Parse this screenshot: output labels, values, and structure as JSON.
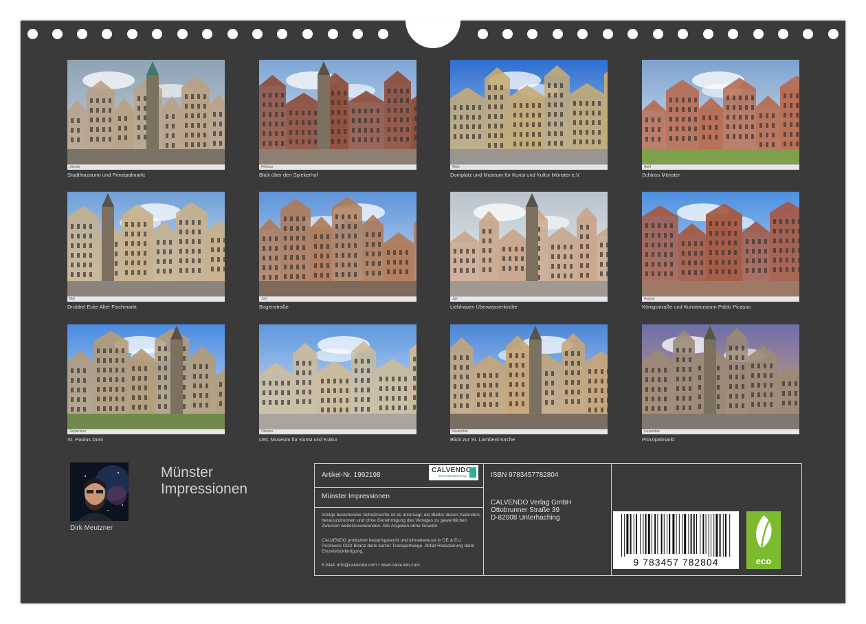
{
  "photos": [
    {
      "caption": "Stadthausturm und Prinzipalmarkt",
      "month": "Januar"
    },
    {
      "caption": "Blick über den Spiekerhof",
      "month": "Februar"
    },
    {
      "caption": "Domplatz und Museum für Kunst und Kultur Münster e.V.",
      "month": "März"
    },
    {
      "caption": "Schloss Münster",
      "month": "April"
    },
    {
      "caption": "Drubbel Ecke Alter Fischmarkt",
      "month": "Mai"
    },
    {
      "caption": "Bogenstraße",
      "month": "Juni"
    },
    {
      "caption": "Liebfrauen Überwasserkirche",
      "month": "Juli"
    },
    {
      "caption": "Königsstraße und Kunstmuseum Pablo Picasso",
      "month": "August"
    },
    {
      "caption": "St. Paulus Dom",
      "month": "September"
    },
    {
      "caption": "LWL Museum für Kunst und Kultur",
      "month": "Oktober"
    },
    {
      "caption": "Blick zur St. Lamberti Kirche",
      "month": "November"
    },
    {
      "caption": "Prinzipalmarkt",
      "month": "Dezember"
    }
  ],
  "author": {
    "name": "Dirk Meutzner"
  },
  "cover": {
    "title_line1": "Münster",
    "title_line2": "Impressionen"
  },
  "info": {
    "article_no": "Artikel-Nr. 1992198",
    "product_title": "Münster Impressionen",
    "legal_text": "Infolge bestehender Schutzrechte ist es untersagt, die Blätter dieses Kalenders herauszutrennen und ohne Genehmigung des Verlages zu gewerblichen Zwecken weiterzuverwenden. Alle Angaben ohne Gewähr.",
    "eco_text": "CALVENDO produziert bedarfsgerecht und klimabewusst in DE & EU. Positivere CO2-Bilanz dank kurzer Transportwege. Abfall-Reduzierung dank Einzelstückfertigung.",
    "contact": "E-Mail: info@calvendo.com • www.calvendo.com",
    "isbn": "ISBN 9783457782804",
    "publisher_name": "CALVENDO Verlag GmbH",
    "publisher_street": "Ottobrunner Straße 39",
    "publisher_city": "D-82008 Unterhaching",
    "barcode_digits": "9 783457 782804",
    "logo_brand": "CALVENDO",
    "logo_tagline": "Dein Kalenderverlag",
    "eco_label": "eco"
  },
  "colors": {
    "background": "#3a3a3a",
    "eco_green": "#7cbb2f",
    "calvendo_teal": "#2bb39a"
  }
}
